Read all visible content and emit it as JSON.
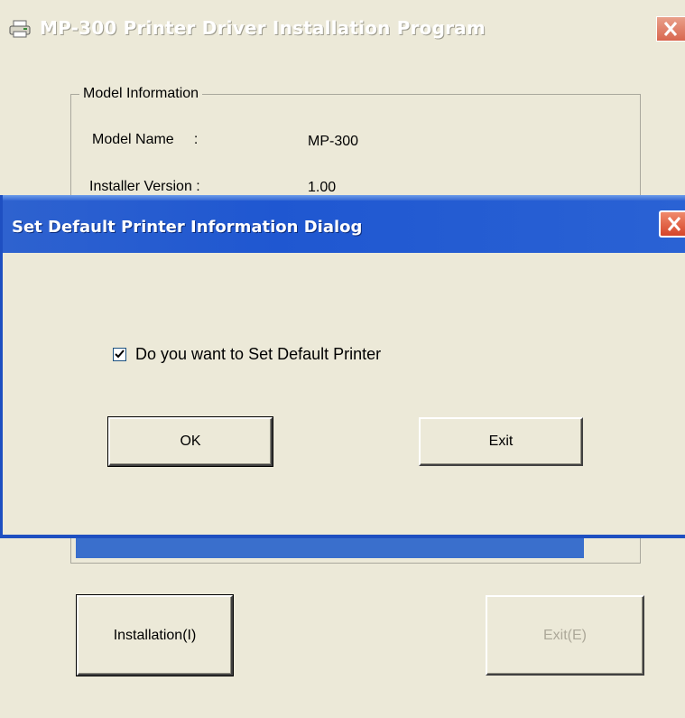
{
  "main_window": {
    "title": "MP-300 Printer Driver Installation Program",
    "group_title": "Model Information",
    "model_name_label": "Model Name     :",
    "model_name_value": "MP-300",
    "installer_version_label": "Installer Version :",
    "installer_version_value": "1.00",
    "install_button": "Installation(I)",
    "exit_button": "Exit(E)",
    "progress_percent": 100
  },
  "dialog": {
    "title": "Set Default Printer Information Dialog",
    "checkbox_label": "Do you want to Set Default Printer",
    "checkbox_checked": true,
    "ok_button": "OK",
    "exit_button": "Exit"
  },
  "colors": {
    "titlebar_blue": "#1f57d1",
    "close_red": "#d6452a",
    "window_bg": "#ece9d8",
    "progress_blue": "#3a6fcc"
  }
}
